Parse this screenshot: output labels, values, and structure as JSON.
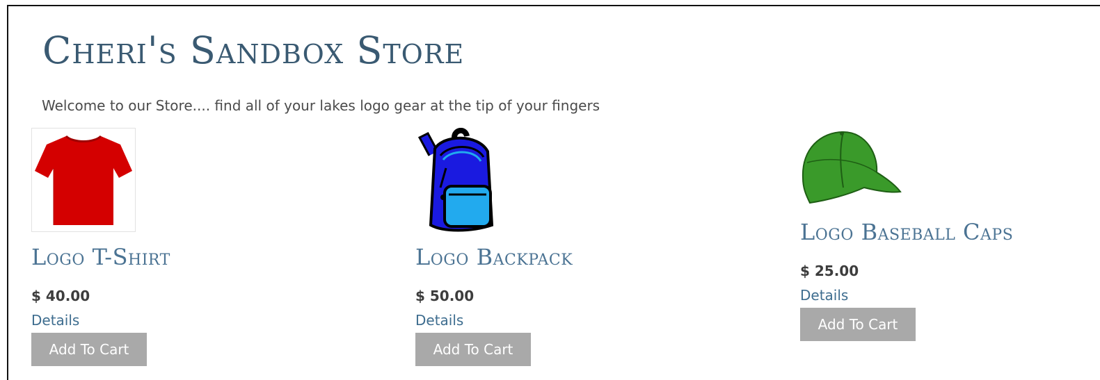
{
  "store": {
    "title": "Cheri's Sandbox Store",
    "welcome": "Welcome to our Store.... find all of your lakes logo gear at the tip of your fingers"
  },
  "products": [
    {
      "name": "Logo T-Shirt",
      "price": "$ 40.00",
      "details_label": "Details",
      "cart_label": "Add To Cart",
      "image": "red-tshirt-image",
      "color": "#d40000"
    },
    {
      "name": "Logo Backpack",
      "price": "$ 50.00",
      "details_label": "Details",
      "cart_label": "Add To Cart",
      "image": "blue-backpack-image",
      "color": "#1a1ae0"
    },
    {
      "name": "Logo Baseball Caps",
      "price": "$ 25.00",
      "details_label": "Details",
      "cart_label": "Add To Cart",
      "image": "green-cap-image",
      "color": "#3a9a2a"
    }
  ]
}
